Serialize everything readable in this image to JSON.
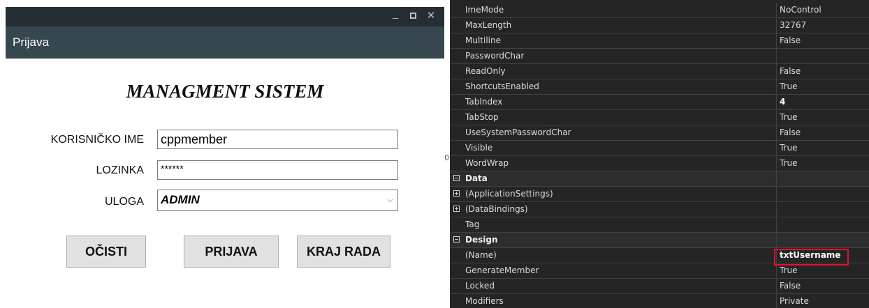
{
  "window": {
    "controls": {
      "minimize": "_",
      "close": "✕"
    },
    "title": "Prijava"
  },
  "form": {
    "heading": "MANAGMENT SISTEM",
    "username_label": "KORISNIČKO IME",
    "username_value": "cppmember",
    "password_label": "LOZINKA",
    "password_value": "******",
    "role_label": "ULOGA",
    "role_value": "ADMIN",
    "role_chevron": "⌵",
    "buttons": {
      "clear": "OČISTI",
      "login": "PRIJAVA",
      "exit": "KRAJ RADA"
    }
  },
  "properties": {
    "rows": [
      {
        "name": "ImeMode",
        "value": "NoControl"
      },
      {
        "name": "MaxLength",
        "value": "32767"
      },
      {
        "name": "Multiline",
        "value": "False"
      },
      {
        "name": "PasswordChar",
        "value": ""
      },
      {
        "name": "ReadOnly",
        "value": "False"
      },
      {
        "name": "ShortcutsEnabled",
        "value": "True"
      },
      {
        "name": "TabIndex",
        "value": "4"
      },
      {
        "name": "TabStop",
        "value": "True"
      },
      {
        "name": "UseSystemPasswordChar",
        "value": "False"
      },
      {
        "name": "Visible",
        "value": "True"
      },
      {
        "name": "WordWrap",
        "value": "True"
      },
      {
        "name": "Data",
        "value": ""
      },
      {
        "name": "(ApplicationSettings)",
        "value": ""
      },
      {
        "name": "(DataBindings)",
        "value": ""
      },
      {
        "name": "Tag",
        "value": ""
      },
      {
        "name": "Design",
        "value": ""
      },
      {
        "name": "(Name)",
        "value": "txtUsername"
      },
      {
        "name": "GenerateMember",
        "value": "True"
      },
      {
        "name": "Locked",
        "value": "False"
      },
      {
        "name": "Modifiers",
        "value": "Private"
      }
    ],
    "highlight_color": "#e81123"
  }
}
